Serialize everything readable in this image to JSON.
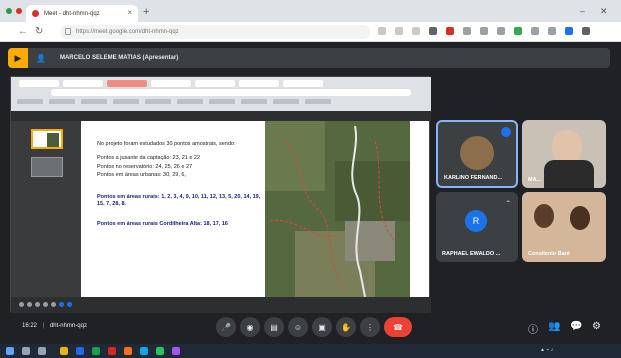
{
  "browser": {
    "tab_title": "Meet - dht-nhmn-qqz",
    "new_tab": "+",
    "url": "https://meet.google.com/dht-nhmn-qqz",
    "window_minimize": "–",
    "window_close": "✕"
  },
  "meet": {
    "presenter_bar": "MARCELO SELEME MATIAS (Apresentar)",
    "slide": {
      "intro": "No projeto foram estudados 30 pontos amostrais, sendo:",
      "line1": "Pontos a jusante da captação: 23, 21 e 22",
      "line2": "Pontos no reservatório: 24, 25, 26 e 27",
      "line3": "Pontos em áreas urbanas: 30, 29, 6,",
      "rural": "Pontos em áreas rurais: 1, 2, 3, 4, 9, 10, 11, 12, 13, 5, 20, 14, 19, 15, 7, 28, 8.",
      "cordilheira": "Pontos em áreas rurais Cordilheira Alta: 18, 17, 16"
    },
    "participants": [
      {
        "name": "KARLINO FERNAND...",
        "avatar_color": "#8d6e4a"
      },
      {
        "name": "MA...",
        "avatar_color": "#c9c1b5"
      },
      {
        "name": "RAPHAEL EWALDO ...",
        "initial": "R",
        "avatar_color": "#1a73e8"
      },
      {
        "name": "Consilenio Baré",
        "avatar_color": "#d4b79a"
      }
    ],
    "time": "16:22",
    "meeting_code": "dht-nhmn-qqz"
  },
  "colors": {
    "accent": "#f9ab00",
    "end_call": "#ea4335",
    "meet_bg": "#202124"
  }
}
